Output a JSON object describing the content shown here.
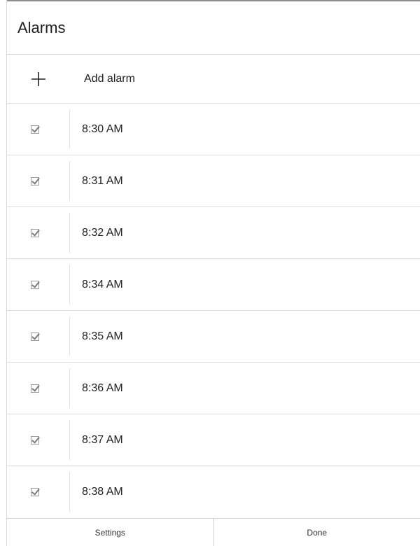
{
  "header": {
    "title": "Alarms"
  },
  "add_row": {
    "label": "Add alarm",
    "icon": "plus-icon"
  },
  "alarms": [
    {
      "time": "8:30 AM",
      "enabled": true
    },
    {
      "time": "8:31 AM",
      "enabled": true
    },
    {
      "time": "8:32 AM",
      "enabled": true
    },
    {
      "time": "8:34 AM",
      "enabled": true
    },
    {
      "time": "8:35 AM",
      "enabled": true
    },
    {
      "time": "8:36 AM",
      "enabled": true
    },
    {
      "time": "8:37 AM",
      "enabled": true
    },
    {
      "time": "8:38 AM",
      "enabled": true
    }
  ],
  "footer": {
    "settings_label": "Settings",
    "done_label": "Done"
  }
}
